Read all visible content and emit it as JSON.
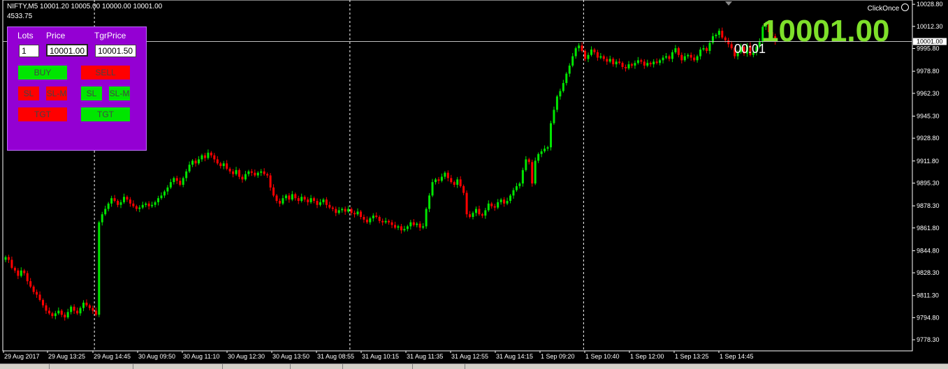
{
  "header": {
    "symbol_info": "NIFTY,M5  10001.20 10005.00 10000.00 10001.00",
    "subinfo": "4533.75"
  },
  "clickonce_label": "ClickOnce",
  "big_price": "10001.00",
  "timer": "00:01",
  "panel": {
    "lots_label": "Lots",
    "price_label": "Price",
    "tgrprice_label": "TgrPrice",
    "lots_value": "1",
    "price_value": "10001.00",
    "tgrprice_value": "10001.50",
    "buy_label": "BUY",
    "sell_label": "SELL",
    "sl_red_label": "SL",
    "slm_red_label": "SL-M",
    "sl_green_label": "SL",
    "slm_green_label": "SL-M",
    "tgt_red_label": "TGT",
    "tgt_green_label": "TGT"
  },
  "colors": {
    "up": "#00e600",
    "down": "#ff0000",
    "panel_bg": "#9400d3",
    "big_price": "#7ee02a"
  },
  "chart_data": {
    "type": "candlestick",
    "timeframe": "M5",
    "ylim": [
      9770,
      10032
    ],
    "y_ticks": [
      "10028.80",
      "10012.30",
      "9995.80",
      "9978.80",
      "9962.30",
      "9945.30",
      "9928.80",
      "9911.80",
      "9895.30",
      "9878.30",
      "9861.80",
      "9844.80",
      "9828.30",
      "9811.30",
      "9794.80",
      "9778.30"
    ],
    "current_price": 10001.0,
    "current_price_label": "10001.00",
    "x_labels": [
      "29 Aug 2017",
      "29 Aug 13:25",
      "29 Aug 14:45",
      "30 Aug 09:50",
      "30 Aug 11:10",
      "30 Aug 12:30",
      "30 Aug 13:50",
      "31 Aug 08:55",
      "31 Aug 10:15",
      "31 Aug 11:35",
      "31 Aug 12:55",
      "31 Aug 14:15",
      "1 Sep 09:20",
      "1 Sep 10:40",
      "1 Sep 12:00",
      "1 Sep 13:25",
      "1 Sep 14:45"
    ],
    "session_separators": [
      29,
      111,
      186
    ],
    "closes": [
      9840,
      9838,
      9832,
      9830,
      9826,
      9830,
      9828,
      9822,
      9818,
      9814,
      9812,
      9808,
      9804,
      9800,
      9798,
      9796,
      9798,
      9800,
      9797,
      9795,
      9799,
      9803,
      9800,
      9798,
      9802,
      9806,
      9804,
      9802,
      9800,
      9797,
      9866,
      9872,
      9876,
      9880,
      9884,
      9882,
      9879,
      9881,
      9885,
      9883,
      9880,
      9878,
      9876,
      9877,
      9879,
      9880,
      9878,
      9879,
      9881,
      9884,
      9886,
      9889,
      9892,
      9896,
      9899,
      9897,
      9894,
      9899,
      9904,
      9909,
      9912,
      9910,
      9913,
      9916,
      9914,
      9918,
      9916,
      9913,
      9910,
      9908,
      9910,
      9906,
      9904,
      9902,
      9905,
      9900,
      9898,
      9902,
      9904,
      9903,
      9901,
      9903,
      9904,
      9902,
      9901,
      9892,
      9886,
      9882,
      9880,
      9884,
      9886,
      9883,
      9887,
      9884,
      9882,
      9885,
      9883,
      9881,
      9884,
      9882,
      9879,
      9881,
      9883,
      9879,
      9877,
      9876,
      9873,
      9875,
      9876,
      9874,
      9876,
      9873,
      9872,
      9874,
      9870,
      9868,
      9866,
      9869,
      9871,
      9870,
      9867,
      9866,
      9867,
      9866,
      9864,
      9862,
      9863,
      9860,
      9861,
      9863,
      9866,
      9864,
      9865,
      9862,
      9863,
      9876,
      9886,
      9896,
      9898,
      9897,
      9900,
      9903,
      9899,
      9896,
      9894,
      9898,
      9893,
      9888,
      9872,
      9870,
      9873,
      9876,
      9872,
      9871,
      9875,
      9880,
      9878,
      9877,
      9881,
      9883,
      9880,
      9882,
      9886,
      9890,
      9893,
      9895,
      9905,
      9913,
      9911,
      9895,
      9912,
      9917,
      9919,
      9921,
      9922,
      9940,
      9950,
      9960,
      9964,
      9970,
      9977,
      9983,
      9990,
      9996,
      9998,
      9994,
      9988,
      9991,
      9995,
      9993,
      9989,
      9990,
      9988,
      9986,
      9988,
      9984,
      9986,
      9985,
      9982,
      9981,
      9984,
      9983,
      9985,
      9987,
      9986,
      9983,
      9985,
      9984,
      9986,
      9985,
      9987,
      9989,
      9990,
      9988,
      9993,
      9996,
      9991,
      9987,
      9990,
      9991,
      9989,
      9987,
      9990,
      9995,
      9996,
      9994,
      10000,
      10005,
      10006,
      10009,
      10004,
      10002,
      9999,
      9996,
      9990,
      9993,
      9997,
      9992,
      9998,
      9991,
      9993,
      9997,
      10001,
      10012,
      10014,
      10008,
      10005,
      10001
    ]
  }
}
